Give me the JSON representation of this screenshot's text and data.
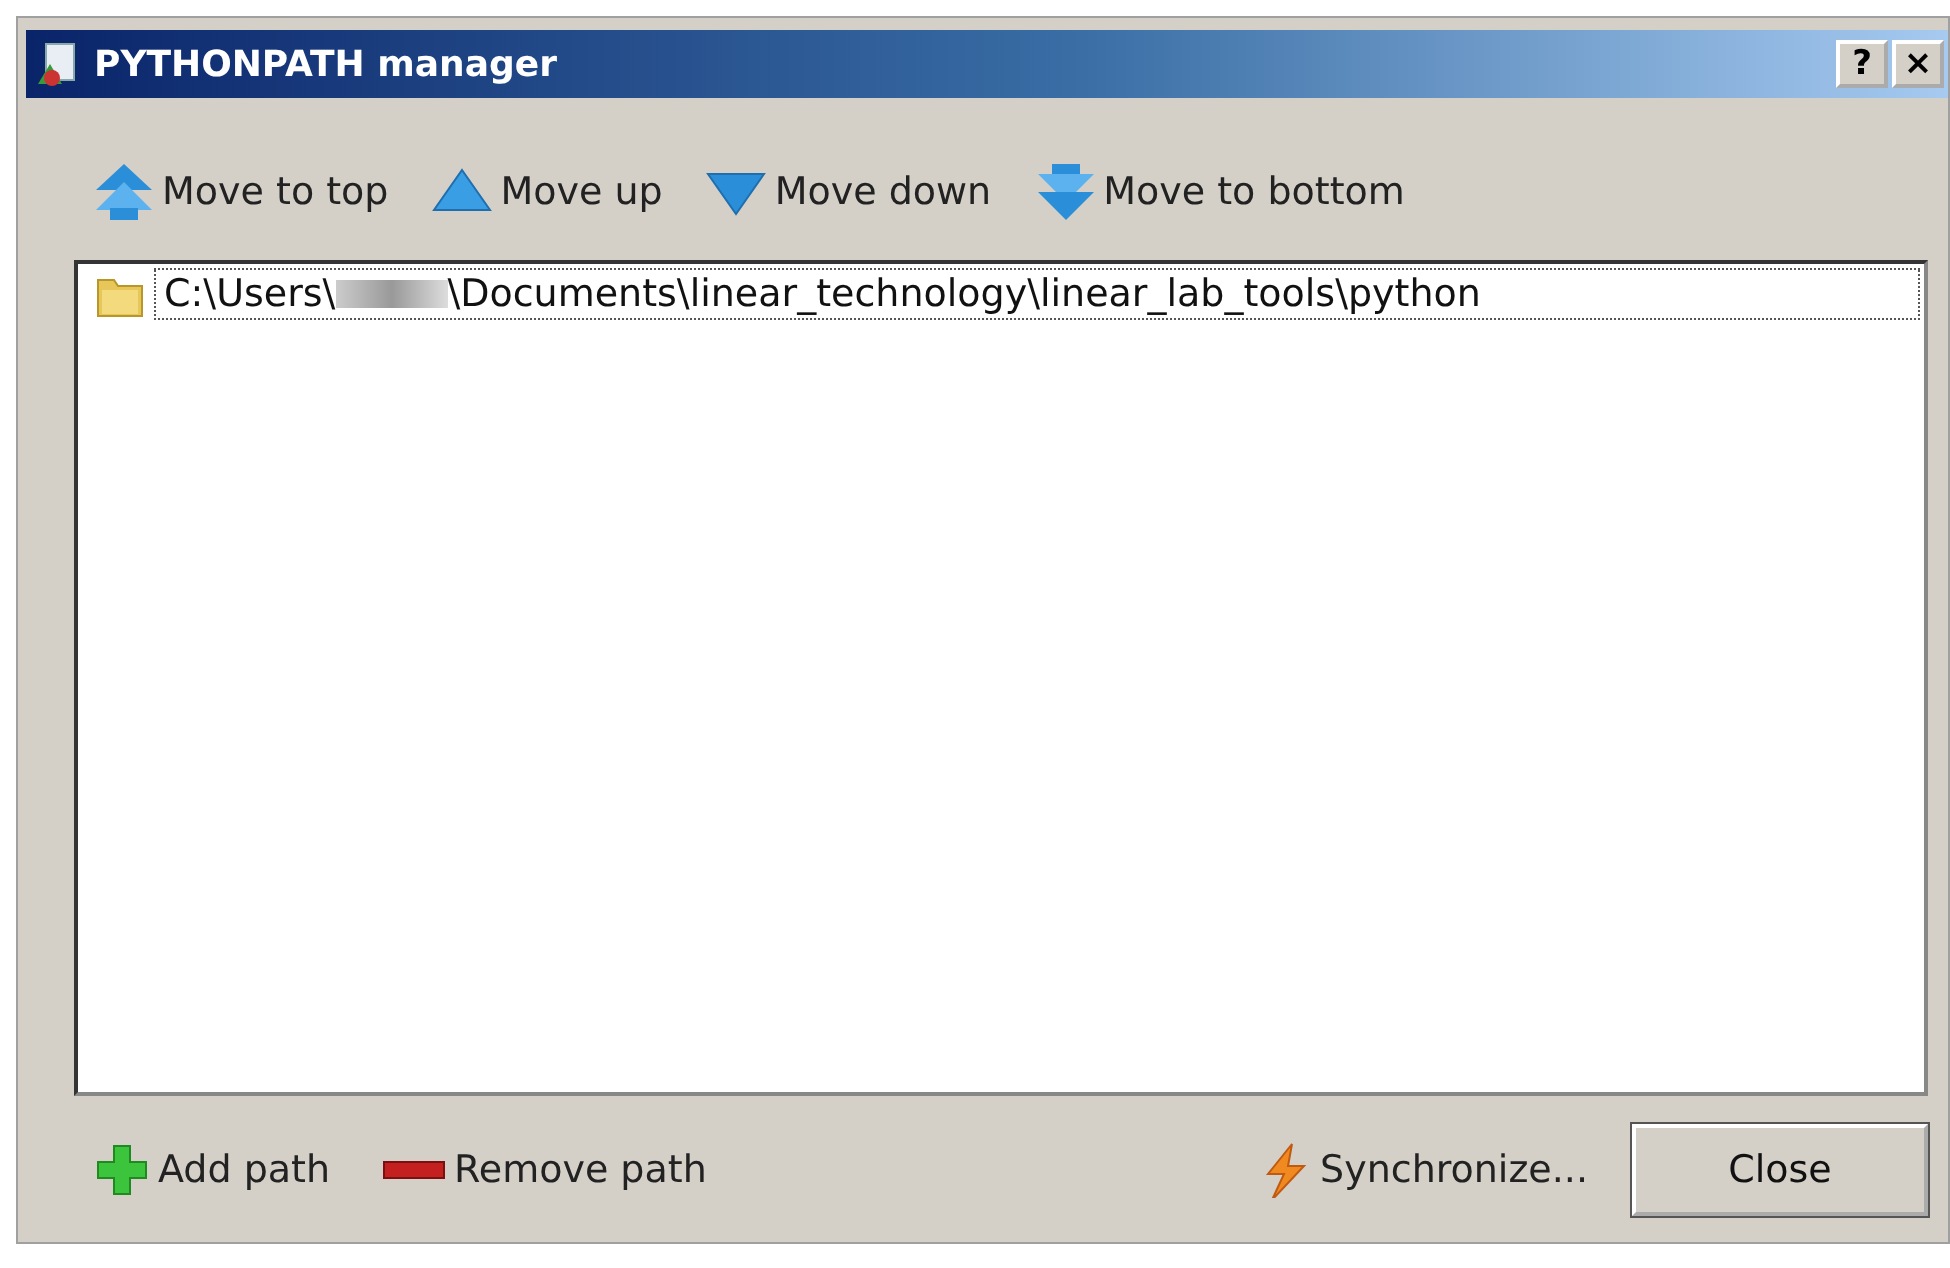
{
  "window": {
    "title": "PYTHONPATH manager",
    "title_buttons": [
      "?",
      "×"
    ]
  },
  "toolbar": [
    {
      "kind": "top",
      "label": "Move to top"
    },
    {
      "kind": "up",
      "label": "Move up"
    },
    {
      "kind": "down",
      "label": "Move down"
    },
    {
      "kind": "bottom",
      "label": "Move to bottom"
    }
  ],
  "paths": [
    {
      "prefix": "C:\\Users\\",
      "suffix": "\\Documents\\linear_technology\\linear_lab_tools\\python",
      "redacted": true,
      "selected": true
    }
  ],
  "actions": [
    {
      "kind": "add",
      "label": "Add path"
    },
    {
      "kind": "remove",
      "label": "Remove path"
    },
    {
      "kind": "sync",
      "label": "Synchronize..."
    }
  ],
  "close_button": "Close"
}
